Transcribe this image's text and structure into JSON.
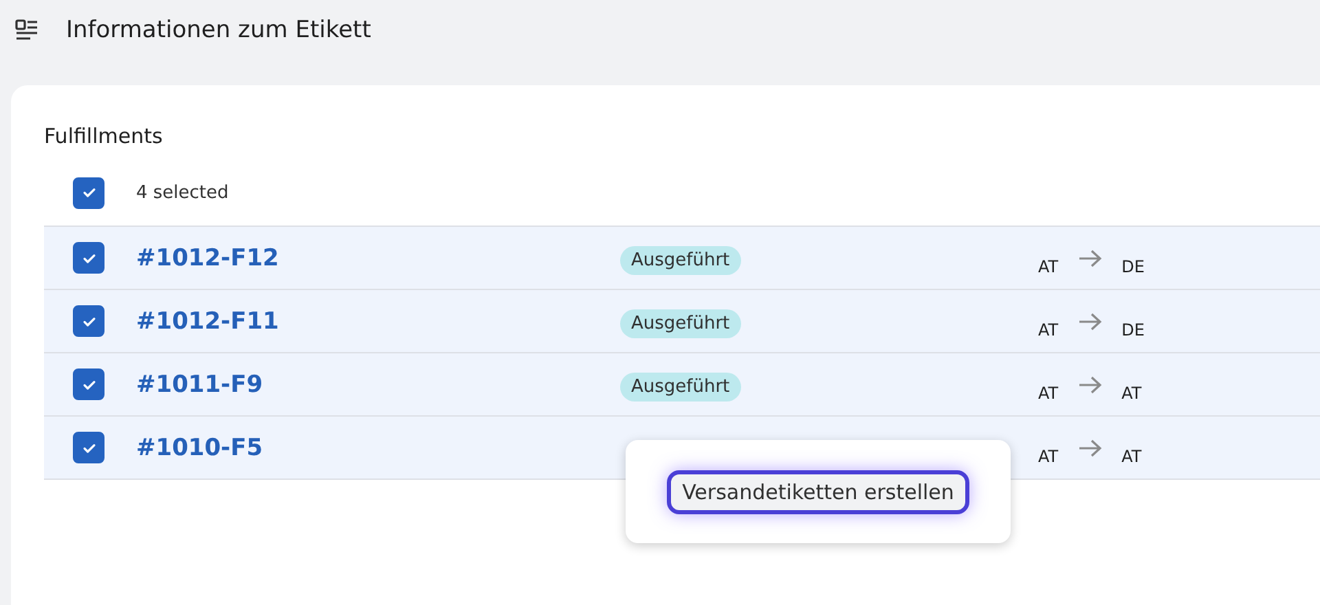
{
  "header": {
    "title": "Informationen zum Etikett"
  },
  "card": {
    "title": "Fulfillments",
    "select_all": {
      "checked": true,
      "label": "4 selected"
    }
  },
  "rows": [
    {
      "checked": true,
      "id": "#1012-F12",
      "status": "Ausgeführt",
      "from": "AT",
      "to": "DE"
    },
    {
      "checked": true,
      "id": "#1012-F11",
      "status": "Ausgeführt",
      "from": "AT",
      "to": "DE"
    },
    {
      "checked": true,
      "id": "#1011-F9",
      "status": "Ausgeführt",
      "from": "AT",
      "to": "AT"
    },
    {
      "checked": true,
      "id": "#1010-F5",
      "from": "AT",
      "to": "AT"
    }
  ],
  "popover": {
    "button": "Versandetiketten erstellen"
  }
}
